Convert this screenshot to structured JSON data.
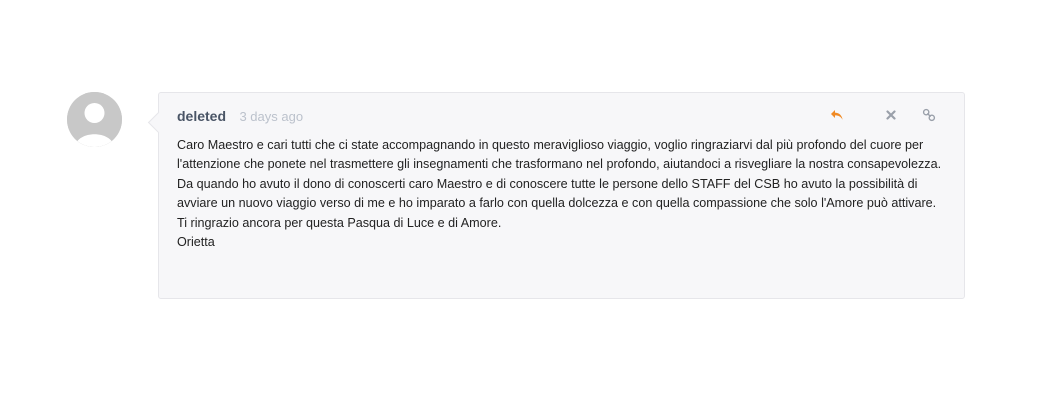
{
  "comment": {
    "author": "deleted",
    "time": "3 days ago",
    "lines": [
      "Caro Maestro e cari tutti che ci state accompagnando in questo meraviglioso viaggio, voglio ringraziarvi dal più profondo del cuore per l'attenzione che ponete nel trasmettere gli insegnamenti che trasformano nel profondo, aiutandoci a risvegliare la nostra consapevolezza.",
      "Da quando ho avuto il dono di conoscerti caro Maestro e di conoscere tutte le persone dello STAFF del CSB  ho avuto la possibilità di avviare un nuovo viaggio verso di me e ho imparato a farlo con quella dolcezza e con quella compassione che solo l'Amore può attivare.",
      "Ti ringrazio ancora per questa Pasqua di Luce e di Amore.",
      "Orietta"
    ],
    "actions": {
      "reply_icon": "reply-icon",
      "close_icon": "close-icon",
      "link_icon": "link-icon"
    },
    "colors": {
      "reply": "#f08a24",
      "muted_icon": "#9aa0aa",
      "author": "#4a5566",
      "time": "#bcc2cc",
      "bubble_bg": "#f7f7f9"
    }
  }
}
